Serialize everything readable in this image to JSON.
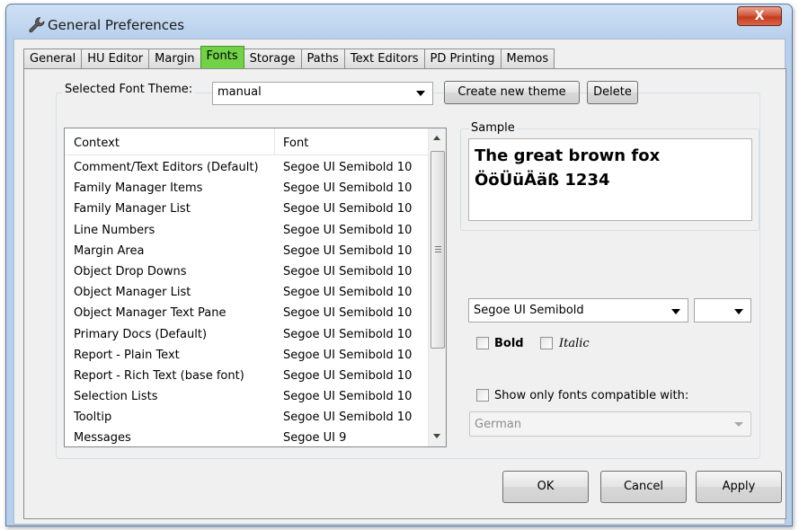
{
  "window": {
    "title": "General Preferences",
    "close_glyph": "X"
  },
  "tabs": [
    {
      "label": "General"
    },
    {
      "label": "HU Editor"
    },
    {
      "label": "Margin"
    },
    {
      "label": "Fonts",
      "active": true
    },
    {
      "label": "Storage"
    },
    {
      "label": "Paths"
    },
    {
      "label": "Text Editors"
    },
    {
      "label": "PD Printing"
    },
    {
      "label": "Memos"
    }
  ],
  "theme": {
    "label": "Selected Font Theme:",
    "selected": "manual",
    "create_button": "Create new theme",
    "delete_button": "Delete"
  },
  "font_list": {
    "headers": {
      "context": "Context",
      "font": "Font"
    },
    "rows": [
      {
        "context": "Comment/Text Editors (Default)",
        "font": "Segoe UI Semibold 10"
      },
      {
        "context": "Family Manager Items",
        "font": "Segoe UI Semibold 10"
      },
      {
        "context": "Family Manager List",
        "font": "Segoe UI Semibold 10"
      },
      {
        "context": "Line Numbers",
        "font": "Segoe UI Semibold 10"
      },
      {
        "context": "Margin Area",
        "font": "Segoe UI Semibold 10"
      },
      {
        "context": "Object Drop Downs",
        "font": "Segoe UI Semibold 10"
      },
      {
        "context": "Object Manager List",
        "font": "Segoe UI Semibold 10"
      },
      {
        "context": "Object Manager Text Pane",
        "font": "Segoe UI Semibold 10"
      },
      {
        "context": "Primary Docs (Default)",
        "font": "Segoe UI Semibold 10"
      },
      {
        "context": "Report - Plain Text",
        "font": "Segoe UI Semibold 10"
      },
      {
        "context": "Report - Rich Text (base font)",
        "font": "Segoe UI Semibold 10"
      },
      {
        "context": "Selection Lists",
        "font": "Segoe UI Semibold 10"
      },
      {
        "context": "Tooltip",
        "font": "Segoe UI Semibold 10"
      },
      {
        "context": "Messages",
        "font": "Segoe UI 9"
      }
    ]
  },
  "sample": {
    "label": "Sample",
    "line1": "The great brown fox",
    "line2": "ÖöÜüÄäß 1234"
  },
  "font_settings": {
    "font_name": "Segoe UI Semibold",
    "font_size": "",
    "bold_label": "Bold",
    "italic_label": "Italic",
    "compat_label": "Show only fonts compatible with:",
    "compat_language": "German"
  },
  "buttons": {
    "ok": "OK",
    "cancel": "Cancel",
    "apply": "Apply"
  },
  "colors": {
    "active_tab": "#71d246",
    "close_button": "#c43b1e",
    "title_bar": "#bcd3ee"
  }
}
